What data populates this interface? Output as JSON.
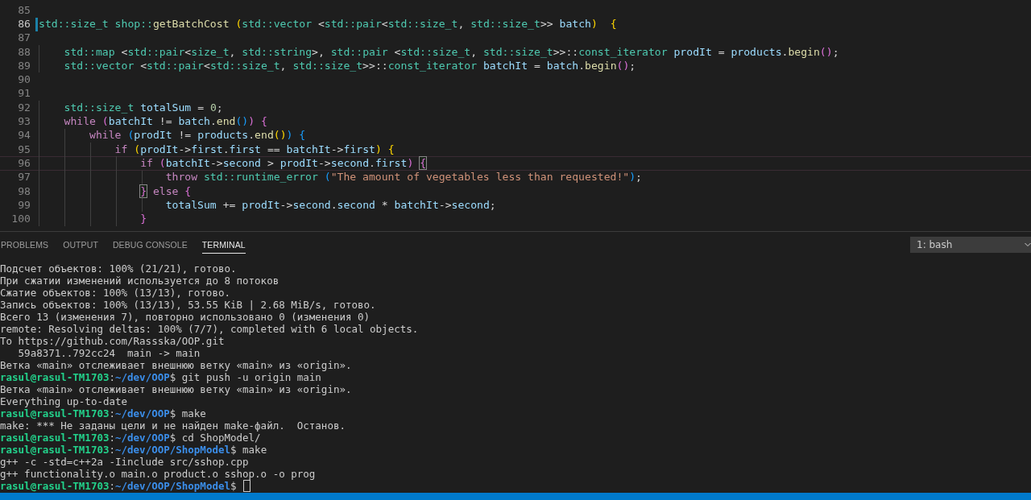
{
  "editor": {
    "lines": [
      {
        "number": "85",
        "modified": false,
        "current": false
      },
      {
        "number": "86",
        "modified": true,
        "current": false,
        "segments": [
          {
            "text": "std::size_t",
            "kind": "type"
          },
          {
            "text": " shop::",
            "kind": "type"
          },
          {
            "text": "getBatchCost",
            "kind": "func"
          },
          {
            "text": " (",
            "kind": "p1"
          },
          {
            "text": "std::vector",
            "kind": "type"
          },
          {
            "text": " <",
            "kind": "op"
          },
          {
            "text": "std::pair",
            "kind": "type"
          },
          {
            "text": "<",
            "kind": "op"
          },
          {
            "text": "std::size_t",
            "kind": "type"
          },
          {
            "text": ", ",
            "kind": "op"
          },
          {
            "text": "std::size_t",
            "kind": "type"
          },
          {
            "text": ">> ",
            "kind": "op"
          },
          {
            "text": "batch",
            "kind": "var"
          },
          {
            "text": ")",
            "kind": "p1"
          },
          {
            "text": "  {",
            "kind": "p1"
          }
        ]
      },
      {
        "number": "87",
        "modified": false,
        "current": false
      },
      {
        "number": "88",
        "modified": false,
        "current": false,
        "segments": [
          {
            "text": "    std::map",
            "kind": "type"
          },
          {
            "text": " <",
            "kind": "op"
          },
          {
            "text": "std::pair",
            "kind": "type"
          },
          {
            "text": "<",
            "kind": "op"
          },
          {
            "text": "size_t",
            "kind": "type"
          },
          {
            "text": ", ",
            "kind": "op"
          },
          {
            "text": "std::string",
            "kind": "type"
          },
          {
            "text": ">, ",
            "kind": "op"
          },
          {
            "text": "std::pair",
            "kind": "type"
          },
          {
            "text": " <",
            "kind": "op"
          },
          {
            "text": "std::size_t",
            "kind": "type"
          },
          {
            "text": ", ",
            "kind": "op"
          },
          {
            "text": "std::size_t",
            "kind": "type"
          },
          {
            "text": ">>::",
            "kind": "op"
          },
          {
            "text": "const_iterator",
            "kind": "type"
          },
          {
            "text": " prodIt",
            "kind": "var"
          },
          {
            "text": " = ",
            "kind": "op"
          },
          {
            "text": "products",
            "kind": "var"
          },
          {
            "text": ".",
            "kind": "op"
          },
          {
            "text": "begin",
            "kind": "func"
          },
          {
            "text": "()",
            "kind": "p2"
          },
          {
            "text": ";",
            "kind": "op"
          }
        ]
      },
      {
        "number": "89",
        "modified": false,
        "current": false,
        "segments": [
          {
            "text": "    std::vector",
            "kind": "type"
          },
          {
            "text": " <",
            "kind": "op"
          },
          {
            "text": "std::pair",
            "kind": "type"
          },
          {
            "text": "<",
            "kind": "op"
          },
          {
            "text": "std::size_t",
            "kind": "type"
          },
          {
            "text": ", ",
            "kind": "op"
          },
          {
            "text": "std::size_t",
            "kind": "type"
          },
          {
            "text": ">>::",
            "kind": "op"
          },
          {
            "text": "const_iterator",
            "kind": "type"
          },
          {
            "text": " batchIt",
            "kind": "var"
          },
          {
            "text": " = ",
            "kind": "op"
          },
          {
            "text": "batch",
            "kind": "var"
          },
          {
            "text": ".",
            "kind": "op"
          },
          {
            "text": "begin",
            "kind": "func"
          },
          {
            "text": "()",
            "kind": "p2"
          },
          {
            "text": ";",
            "kind": "op"
          }
        ]
      },
      {
        "number": "90",
        "modified": false,
        "current": false
      },
      {
        "number": "91",
        "modified": false,
        "current": false
      },
      {
        "number": "92",
        "modified": false,
        "current": false,
        "segments": [
          {
            "text": "    std::size_t",
            "kind": "type"
          },
          {
            "text": " totalSum",
            "kind": "var"
          },
          {
            "text": " = ",
            "kind": "op"
          },
          {
            "text": "0",
            "kind": "number"
          },
          {
            "text": ";",
            "kind": "op"
          }
        ]
      },
      {
        "number": "93",
        "modified": false,
        "current": false,
        "segments": [
          {
            "text": "    while",
            "kind": "keyword"
          },
          {
            "text": " (",
            "kind": "p2"
          },
          {
            "text": "batchIt",
            "kind": "var"
          },
          {
            "text": " != ",
            "kind": "op"
          },
          {
            "text": "batch",
            "kind": "var"
          },
          {
            "text": ".",
            "kind": "op"
          },
          {
            "text": "end",
            "kind": "func"
          },
          {
            "text": "()",
            "kind": "p3"
          },
          {
            "text": ")",
            "kind": "p2"
          },
          {
            "text": " {",
            "kind": "p2"
          }
        ]
      },
      {
        "number": "94",
        "modified": false,
        "current": false,
        "segments": [
          {
            "text": "        while",
            "kind": "keyword"
          },
          {
            "text": " (",
            "kind": "p3"
          },
          {
            "text": "prodIt",
            "kind": "var"
          },
          {
            "text": " != ",
            "kind": "op"
          },
          {
            "text": "products",
            "kind": "var"
          },
          {
            "text": ".",
            "kind": "op"
          },
          {
            "text": "end",
            "kind": "func"
          },
          {
            "text": "()",
            "kind": "p1"
          },
          {
            "text": ")",
            "kind": "p3"
          },
          {
            "text": " {",
            "kind": "p3"
          }
        ]
      },
      {
        "number": "95",
        "modified": false,
        "current": false,
        "segments": [
          {
            "text": "            if",
            "kind": "keyword"
          },
          {
            "text": " (",
            "kind": "p1"
          },
          {
            "text": "prodIt",
            "kind": "var"
          },
          {
            "text": "->",
            "kind": "op"
          },
          {
            "text": "first",
            "kind": "var"
          },
          {
            "text": ".",
            "kind": "op"
          },
          {
            "text": "first",
            "kind": "var"
          },
          {
            "text": " == ",
            "kind": "op"
          },
          {
            "text": "batchIt",
            "kind": "var"
          },
          {
            "text": "->",
            "kind": "op"
          },
          {
            "text": "first",
            "kind": "var"
          },
          {
            "text": ")",
            "kind": "p1"
          },
          {
            "text": " {",
            "kind": "p1"
          }
        ]
      },
      {
        "number": "96",
        "modified": false,
        "current": true,
        "segments": [
          {
            "text": "                if",
            "kind": "keyword"
          },
          {
            "text": " (",
            "kind": "p2"
          },
          {
            "text": "batchIt",
            "kind": "var"
          },
          {
            "text": "->",
            "kind": "op"
          },
          {
            "text": "second",
            "kind": "var"
          },
          {
            "text": " > ",
            "kind": "op"
          },
          {
            "text": "prodIt",
            "kind": "var"
          },
          {
            "text": "->",
            "kind": "op"
          },
          {
            "text": "second",
            "kind": "var"
          },
          {
            "text": ".",
            "kind": "op"
          },
          {
            "text": "first",
            "kind": "var"
          },
          {
            "text": ") ",
            "kind": "p2"
          },
          {
            "text": "{",
            "kind": "match"
          }
        ]
      },
      {
        "number": "97",
        "modified": false,
        "current": false,
        "segments": [
          {
            "text": "                    throw",
            "kind": "keyword"
          },
          {
            "text": " std::runtime_error",
            "kind": "type"
          },
          {
            "text": " (",
            "kind": "p3"
          },
          {
            "text": "\"The amount of vegetables less than requested!\"",
            "kind": "string"
          },
          {
            "text": ")",
            "kind": "p3"
          },
          {
            "text": ";",
            "kind": "op"
          }
        ]
      },
      {
        "number": "98",
        "modified": false,
        "current": false,
        "segments": [
          {
            "text": "                }",
            "kind": "match"
          },
          {
            "text": " else",
            "kind": "keyword"
          },
          {
            "text": " {",
            "kind": "p2"
          }
        ]
      },
      {
        "number": "99",
        "modified": false,
        "current": false,
        "segments": [
          {
            "text": "                    totalSum",
            "kind": "var"
          },
          {
            "text": " += ",
            "kind": "op"
          },
          {
            "text": "prodIt",
            "kind": "var"
          },
          {
            "text": "->",
            "kind": "op"
          },
          {
            "text": "second",
            "kind": "var"
          },
          {
            "text": ".",
            "kind": "op"
          },
          {
            "text": "second",
            "kind": "var"
          },
          {
            "text": " * ",
            "kind": "op"
          },
          {
            "text": "batchIt",
            "kind": "var"
          },
          {
            "text": "->",
            "kind": "op"
          },
          {
            "text": "second",
            "kind": "var"
          },
          {
            "text": ";",
            "kind": "op"
          }
        ]
      },
      {
        "number": "100",
        "modified": false,
        "current": false,
        "segments": [
          {
            "text": "                }",
            "kind": "p2"
          }
        ]
      }
    ]
  },
  "panel": {
    "tabs": [
      {
        "label": "PROBLEMS",
        "selected": false
      },
      {
        "label": "OUTPUT",
        "selected": false
      },
      {
        "label": "DEBUG CONSOLE",
        "selected": false
      },
      {
        "label": "TERMINAL",
        "selected": true
      }
    ],
    "terminal_select": {
      "value": "1: bash"
    },
    "terminal": [
      {
        "kind": "output",
        "text": "Подсчет объектов: 100% (21/21), готово."
      },
      {
        "kind": "output",
        "text": "При сжатии изменений используется до 8 потоков"
      },
      {
        "kind": "output",
        "text": "Сжатие объектов: 100% (13/13), готово."
      },
      {
        "kind": "output",
        "text": "Запись объектов: 100% (13/13), 53.55 KiB | 2.68 MiB/s, готово."
      },
      {
        "kind": "output",
        "text": "Всего 13 (изменения 7), повторно использовано 0 (изменения 0)"
      },
      {
        "kind": "output",
        "text": "remote: Resolving deltas: 100% (7/7), completed with 6 local objects."
      },
      {
        "kind": "output",
        "text": "To https://github.com/Rassska/OOP.git"
      },
      {
        "kind": "output",
        "text": "   59a8371..792cc24  main -> main"
      },
      {
        "kind": "output",
        "text": "Ветка «main» отслеживает внешнюю ветку «main» из «origin»."
      },
      {
        "kind": "prompt",
        "user": "rasul@rasul-TM1703",
        "separator": ":",
        "path": "~/dev/OOP",
        "sign": "$",
        "command": "git push -u origin main",
        "cursor": false
      },
      {
        "kind": "output",
        "text": "Ветка «main» отслеживает внешнюю ветку «main» из «origin»."
      },
      {
        "kind": "output",
        "text": "Everything up-to-date"
      },
      {
        "kind": "prompt",
        "user": "rasul@rasul-TM1703",
        "separator": ":",
        "path": "~/dev/OOP",
        "sign": "$",
        "command": "make",
        "cursor": false
      },
      {
        "kind": "output",
        "text": "make: *** Не заданы цели и не найден make-файл.  Останов."
      },
      {
        "kind": "prompt",
        "user": "rasul@rasul-TM1703",
        "separator": ":",
        "path": "~/dev/OOP",
        "sign": "$",
        "command": "cd ShopModel/",
        "cursor": false
      },
      {
        "kind": "prompt",
        "user": "rasul@rasul-TM1703",
        "separator": ":",
        "path": "~/dev/OOP/ShopModel",
        "sign": "$",
        "command": "make",
        "cursor": false
      },
      {
        "kind": "output",
        "text": "g++ -c -std=c++2a -Iinclude src/sshop.cpp"
      },
      {
        "kind": "output",
        "text": "g++ functionality.o main.o product.o sshop.o -o prog"
      },
      {
        "kind": "prompt",
        "user": "rasul@rasul-TM1703",
        "separator": ":",
        "path": "~/dev/OOP/ShopModel",
        "sign": "$",
        "cursor": true
      }
    ]
  }
}
